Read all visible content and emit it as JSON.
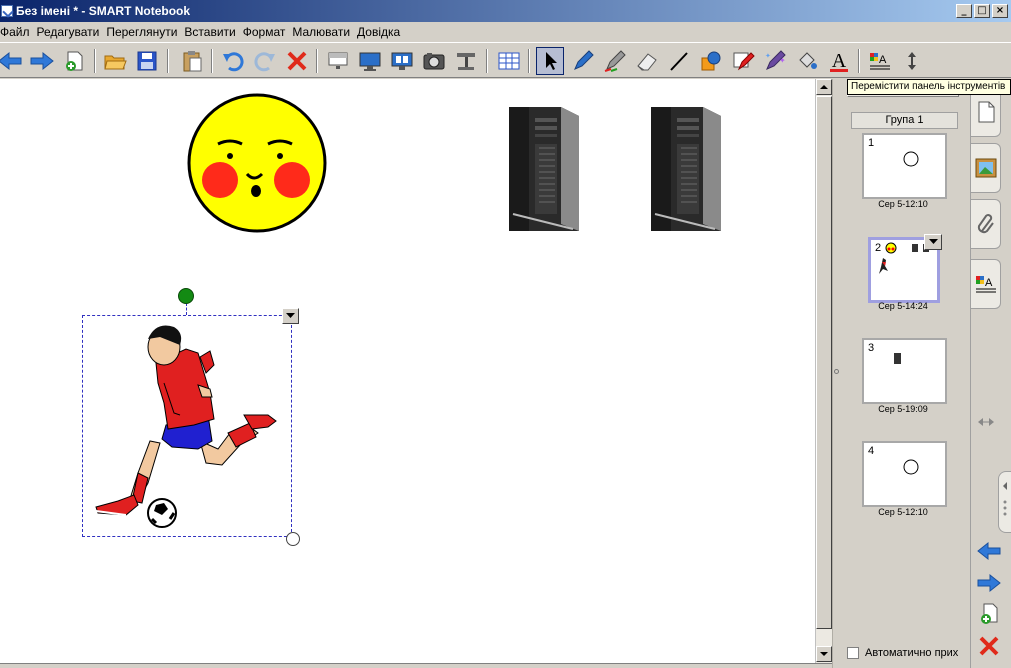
{
  "window": {
    "title": "Без імені * - SMART Notebook",
    "buttons": {
      "minimize": "_",
      "maximize": "□",
      "close": "×"
    }
  },
  "menu": {
    "items": [
      "Файл",
      "Редагувати",
      "Переглянути",
      "Вставити",
      "Формат",
      "Малювати",
      "Довідка"
    ]
  },
  "toolbar": {
    "tools": [
      "back-arrow-icon",
      "forward-arrow-icon",
      "add-page-icon",
      "open-folder-icon",
      "save-icon",
      "paste-icon",
      "undo-icon",
      "redo-icon",
      "delete-icon",
      "screen-shade-icon",
      "full-screen-icon",
      "dual-page-icon",
      "screen-capture-icon",
      "document-camera-icon",
      "table-icon",
      "select-arrow-icon",
      "pen-icon",
      "creative-pen-icon",
      "eraser-icon",
      "line-icon",
      "shapes-icon",
      "magic-pen-icon",
      "fill-icon",
      "text-icon",
      "properties-icon",
      "move-toolbar-icon"
    ],
    "active_tool": "select-arrow-icon",
    "text_tool_letter": "A"
  },
  "tooltip": {
    "text": "Перемістити панель інструментів"
  },
  "canvas": {
    "objects": [
      "smiley-face-image",
      "computer-tower-image-1",
      "computer-tower-image-2",
      "football-player-image"
    ],
    "selected_object": "football-player-image"
  },
  "page_sorter": {
    "group_label": "Група 1",
    "pages": [
      {
        "number": "1",
        "date": "Сер 5-12:10",
        "selected": false
      },
      {
        "number": "2",
        "date": "Сер 5-14:24",
        "selected": true
      },
      {
        "number": "3",
        "date": "Сер 5-19:09",
        "selected": false
      },
      {
        "number": "4",
        "date": "Сер 5-12:10",
        "selected": false
      }
    ],
    "auto_hide_label": "Автоматично прих",
    "auto_hide_checked": false
  },
  "side_tabs": [
    "page-sorter-tab-icon",
    "gallery-tab-icon",
    "attachments-tab-icon",
    "properties-tab-icon"
  ],
  "colors": {
    "title_start": "#0a246a",
    "title_end": "#a6caf0",
    "face_yellow": "#ffff00",
    "cheek_red": "#ff2a1a",
    "shirt_red": "#e02020",
    "shorts_blue": "#2020d0",
    "selection_blue": "#3030c0",
    "rotate_handle_green": "#138a13",
    "nav_blue": "#2f78d8",
    "delete_red": "#e02a1a"
  }
}
